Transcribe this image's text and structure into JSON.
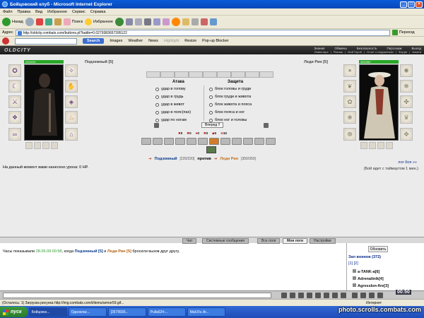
{
  "window": {
    "title": "Бойцовский клуб - Microsoft Internet Explorer"
  },
  "menubar": {
    "items": [
      "Файл",
      "Правка",
      "Вид",
      "Избранное",
      "Сервис",
      "Справка"
    ]
  },
  "toolbar": {
    "back_label": "Назад",
    "search_label": "Поиск",
    "favorites_label": "Избранное"
  },
  "addressbar": {
    "label": "Адрес",
    "url": "http://oldcity.combats.com/buttons.pl?battle=0.0279383657395122",
    "go_label": "Переход"
  },
  "linksbar": {
    "search_button": "Search",
    "links": [
      "Images",
      "Weather",
      "News",
      "Highlight",
      "Resize",
      "Pop-up Blocker"
    ]
  },
  "game_header": {
    "logo": "OLDCITY",
    "nav_top": [
      "Знания",
      "Обмены",
      "Безопасность",
      "Персонаж",
      "Выход"
    ],
    "nav_bottom": [
      "Инвентарь",
      "Рюкзак",
      "Мой Герой",
      "Отчет о нарушениях",
      "Форум",
      "Анкета"
    ]
  },
  "player_left": {
    "name": "Подземный [5]",
    "hp_text": "220/220"
  },
  "player_right": {
    "name": "Леди Рин [5]",
    "hp_text": "350/350"
  },
  "combat": {
    "attack_header": "Атака",
    "defense_header": "Защита",
    "attack_options": [
      "удар в голову",
      "удар в грудь",
      "удар в живот",
      "удар в пояс(пах)",
      "удар по ногам"
    ],
    "defense_options": [
      "блок головы и груди",
      "блок груди и живота",
      "блок живота и пояса",
      "блок пояса и ног",
      "блок ног и головы"
    ],
    "go_button": "Вперед !!",
    "counts": [
      "0",
      "0",
      "0",
      "0",
      "0",
      "10"
    ]
  },
  "versus": {
    "name1": "Подземный",
    "hp1": "[220/220]",
    "word": "против",
    "name2": "Леди Рин",
    "hp2": "[350/350]"
  },
  "log_link": "лог боя »»",
  "timeout_text": "(Бой идет с таймаутом 1 мин.)",
  "damage_message": "На данный момент вами нанесено урона: 0 HP.",
  "chat": {
    "tabs": [
      "Чат",
      "Системные сообщения",
      "Все логи",
      "Мои логи",
      "Настройки"
    ],
    "active_tab": "Мои логи",
    "msg_prefix": "Часы показывали",
    "msg_time": "28.05.09 00:58",
    "msg_mid": ", когда",
    "msg_name1": "Подземный [5]",
    "msg_and": "и",
    "msg_name2": "Леди Рин [5]",
    "msg_suffix": "бросили вызов друг другу."
  },
  "side": {
    "refresh_button": "Обновить",
    "title": "Зал воинов (372)",
    "pages": "[1] [2]",
    "items": [
      "a-TANK-a[6]",
      "Adrenalinik[4]",
      "AgressIon-fire[3]"
    ]
  },
  "clock": "00:50",
  "statusbar": {
    "text": "(Осталось: 1) Загрузка рисунка http://img.combats.com/i/items/armor59.gif...",
    "zone": "Интернет"
  },
  "taskbar": {
    "start": "пуск",
    "tasks": [
      "Бойцовск...",
      "Одноклас...",
      "[3579936...",
      "Pulla624-...",
      "Mail.Ru Аг..."
    ]
  },
  "watermark": "photo.scrolls.combats.com",
  "colors": {
    "title_blue": "#0848b8",
    "hp_green": "#2aa82a",
    "name_blue": "#0a3a8a",
    "name_orange": "#b06010",
    "time_green": "#2a9a2a"
  }
}
